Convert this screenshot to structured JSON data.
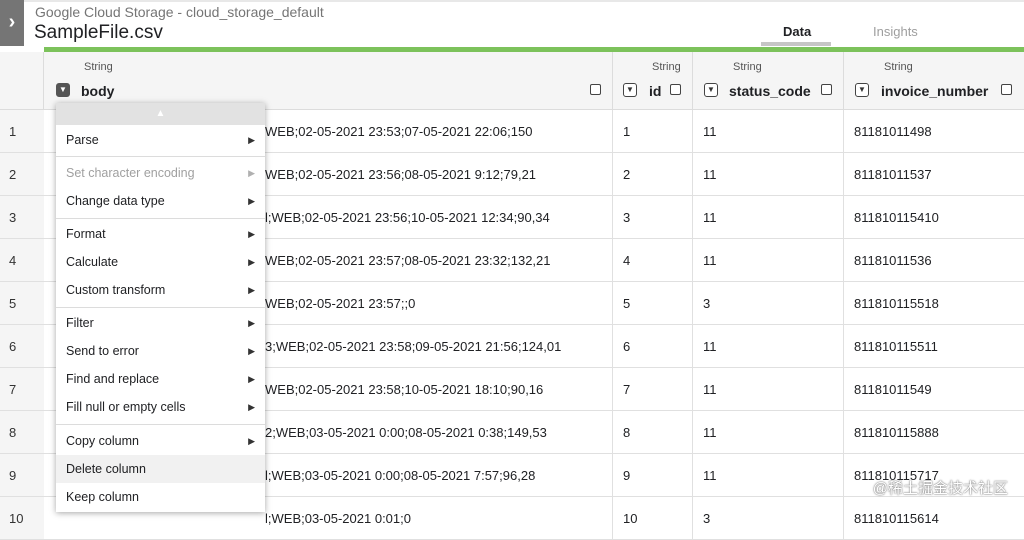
{
  "header": {
    "source": "Google Cloud Storage - cloud_storage_default",
    "filename": "SampleFile.csv",
    "toggle_glyph": "›",
    "tabs": {
      "data": "Data",
      "insights": "Insights"
    }
  },
  "columns": {
    "body": {
      "type": "String",
      "name": "body"
    },
    "id": {
      "type": "String",
      "name": "id"
    },
    "status_code": {
      "type": "String",
      "name": "status_code"
    },
    "invoice_number": {
      "type": "String",
      "name": "invoice_number"
    }
  },
  "rows": [
    {
      "num": "1",
      "body": "WEB;02-05-2021 23:53;07-05-2021 22:06;150",
      "id": "1",
      "status_code": "11",
      "invoice_number": "81181011498"
    },
    {
      "num": "2",
      "body": "WEB;02-05-2021 23:56;08-05-2021 9:12;79,21",
      "id": "2",
      "status_code": "11",
      "invoice_number": "81181011537"
    },
    {
      "num": "3",
      "body": "l;WEB;02-05-2021 23:56;10-05-2021 12:34;90,34",
      "id": "3",
      "status_code": "11",
      "invoice_number": "811810115410"
    },
    {
      "num": "4",
      "body": "WEB;02-05-2021 23:57;08-05-2021 23:32;132,21",
      "id": "4",
      "status_code": "11",
      "invoice_number": "81181011536"
    },
    {
      "num": "5",
      "body": "WEB;02-05-2021 23:57;;0",
      "id": "5",
      "status_code": "3",
      "invoice_number": "811810115518"
    },
    {
      "num": "6",
      "body": "3;WEB;02-05-2021 23:58;09-05-2021 21:56;124,01",
      "id": "6",
      "status_code": "11",
      "invoice_number": "811810115511"
    },
    {
      "num": "7",
      "body": "WEB;02-05-2021 23:58;10-05-2021 18:10;90,16",
      "id": "7",
      "status_code": "11",
      "invoice_number": "81181011549"
    },
    {
      "num": "8",
      "body": "2;WEB;03-05-2021 0:00;08-05-2021 0:38;149,53",
      "id": "8",
      "status_code": "11",
      "invoice_number": "811810115888"
    },
    {
      "num": "9",
      "body": "l;WEB;03-05-2021 0:00;08-05-2021 7:57;96,28",
      "id": "9",
      "status_code": "11",
      "invoice_number": "811810115717"
    },
    {
      "num": "10",
      "body": "l;WEB;03-05-2021 0:01;0",
      "id": "10",
      "status_code": "3",
      "invoice_number": "811810115614"
    }
  ],
  "menu": {
    "items": [
      {
        "label": "Parse",
        "submenu": true,
        "disabled": false
      },
      {
        "label": "Set character encoding",
        "submenu": true,
        "disabled": true
      },
      {
        "label": "Change data type",
        "submenu": true,
        "disabled": false
      },
      {
        "label": "Format",
        "submenu": true,
        "disabled": false
      },
      {
        "label": "Calculate",
        "submenu": true,
        "disabled": false
      },
      {
        "label": "Custom transform",
        "submenu": true,
        "disabled": false
      },
      {
        "label": "Filter",
        "submenu": true,
        "disabled": false
      },
      {
        "label": "Send to error",
        "submenu": true,
        "disabled": false
      },
      {
        "label": "Find and replace",
        "submenu": true,
        "disabled": false
      },
      {
        "label": "Fill null or empty cells",
        "submenu": true,
        "disabled": false
      },
      {
        "label": "Copy column",
        "submenu": true,
        "disabled": false
      },
      {
        "label": "Delete column",
        "submenu": false,
        "disabled": false
      },
      {
        "label": "Keep column",
        "submenu": false,
        "disabled": false
      }
    ],
    "arrow_glyph": "▶",
    "scroll_glyph": "▲"
  },
  "watermark": "@稀土掘金技术社区",
  "colors": {
    "accent_green": "#7cc25b",
    "toggle_gray": "#757575"
  }
}
